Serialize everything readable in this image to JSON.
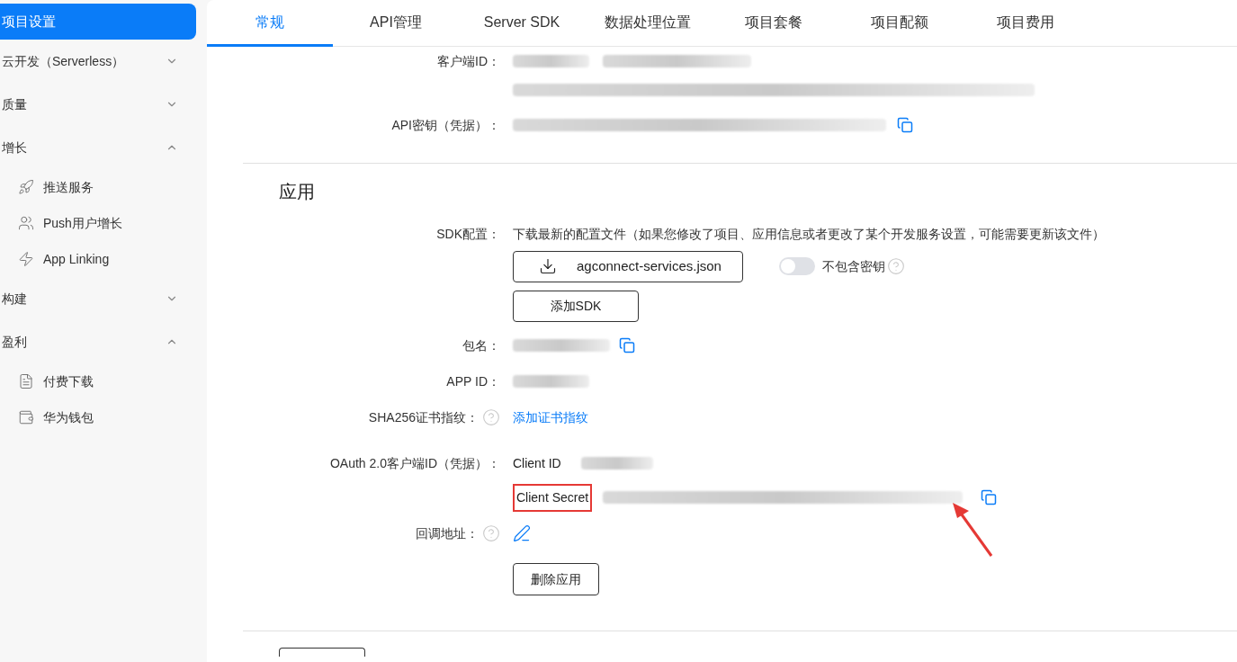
{
  "sidebar": {
    "items": [
      {
        "kind": "link",
        "label": "项目设置",
        "selected": true
      },
      {
        "kind": "group",
        "label": "云开发（Serverless）",
        "expanded": false
      },
      {
        "kind": "group",
        "label": "质量",
        "expanded": false
      },
      {
        "kind": "group",
        "label": "增长",
        "expanded": true,
        "children": [
          {
            "label": "推送服务"
          },
          {
            "label": "Push用户增长"
          },
          {
            "label": "App Linking"
          }
        ]
      },
      {
        "kind": "group",
        "label": "构建",
        "expanded": false
      },
      {
        "kind": "group",
        "label": "盈利",
        "expanded": true,
        "children": [
          {
            "label": "付费下载"
          },
          {
            "label": "华为钱包"
          }
        ]
      }
    ]
  },
  "tabs": [
    {
      "label": "常规",
      "selected": true
    },
    {
      "label": "API管理",
      "selected": false
    },
    {
      "label": "Server SDK",
      "selected": false
    },
    {
      "label": "数据处理位置",
      "selected": false
    },
    {
      "label": "项目套餐",
      "selected": false
    },
    {
      "label": "项目配额",
      "selected": false
    },
    {
      "label": "项目费用",
      "selected": false
    }
  ],
  "credentials": {
    "client_id_label": "客户端ID：",
    "api_key_label": "API密钥（凭据）："
  },
  "app": {
    "title": "应用",
    "sdk_config": {
      "label": "SDK配置：",
      "description": "下载最新的配置文件（如果您修改了项目、应用信息或者更改了某个开发服务设置，可能需要更新该文件）",
      "download_button": "agconnect-services.json",
      "toggle": {
        "label": "不包含密钥",
        "on": false
      },
      "add_sdk_button": "添加SDK"
    },
    "package_name_label": "包名：",
    "app_id_label": "APP ID：",
    "sha256": {
      "label": "SHA256证书指纹：",
      "link": "添加证书指纹"
    },
    "oauth": {
      "label": "OAuth 2.0客户端ID（凭据）：",
      "client_id_label": "Client ID",
      "client_secret_label": "Client Secret",
      "secret_highlighted": true
    },
    "callback_label": "回调地址：",
    "delete_button": "删除应用"
  }
}
